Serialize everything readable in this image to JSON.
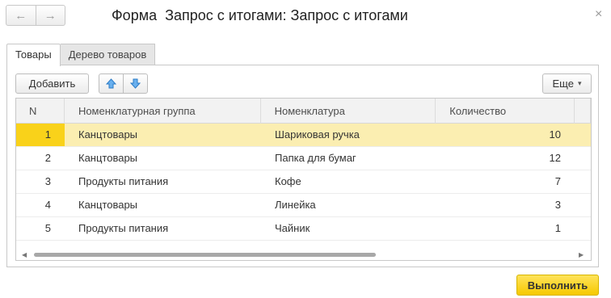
{
  "window": {
    "title": "Форма  Запрос с итогами: Запрос с итогами",
    "back_icon": "←",
    "forward_icon": "→",
    "close_icon": "×"
  },
  "tabs": [
    {
      "label": "Товары",
      "active": true
    },
    {
      "label": "Дерево товаров",
      "active": false
    }
  ],
  "toolbar": {
    "add_label": "Добавить",
    "more_label": "Еще",
    "more_caret": "▾"
  },
  "table": {
    "columns": [
      "N",
      "Номенклатурная группа",
      "Номенклатура",
      "Количество"
    ],
    "rows": [
      {
        "n": "1",
        "group": "Канцтовары",
        "item": "Шариковая ручка",
        "qty": "10",
        "selected": true
      },
      {
        "n": "2",
        "group": "Канцтовары",
        "item": "Папка для бумаг",
        "qty": "12",
        "selected": false
      },
      {
        "n": "3",
        "group": "Продукты питания",
        "item": "Кофе",
        "qty": "7",
        "selected": false
      },
      {
        "n": "4",
        "group": "Канцтовары",
        "item": "Линейка",
        "qty": "3",
        "selected": false
      },
      {
        "n": "5",
        "group": "Продукты питания",
        "item": "Чайник",
        "qty": "1",
        "selected": false
      }
    ]
  },
  "scrollbar": {
    "left_icon": "◀",
    "right_icon": "▶"
  },
  "footer": {
    "run_label": "Выполнить"
  },
  "colors": {
    "selected_row": "#fbeeb1",
    "selected_cell": "#f9d21a",
    "run_button": "#f6c900",
    "arrow_icon": "#3c8fd8"
  }
}
